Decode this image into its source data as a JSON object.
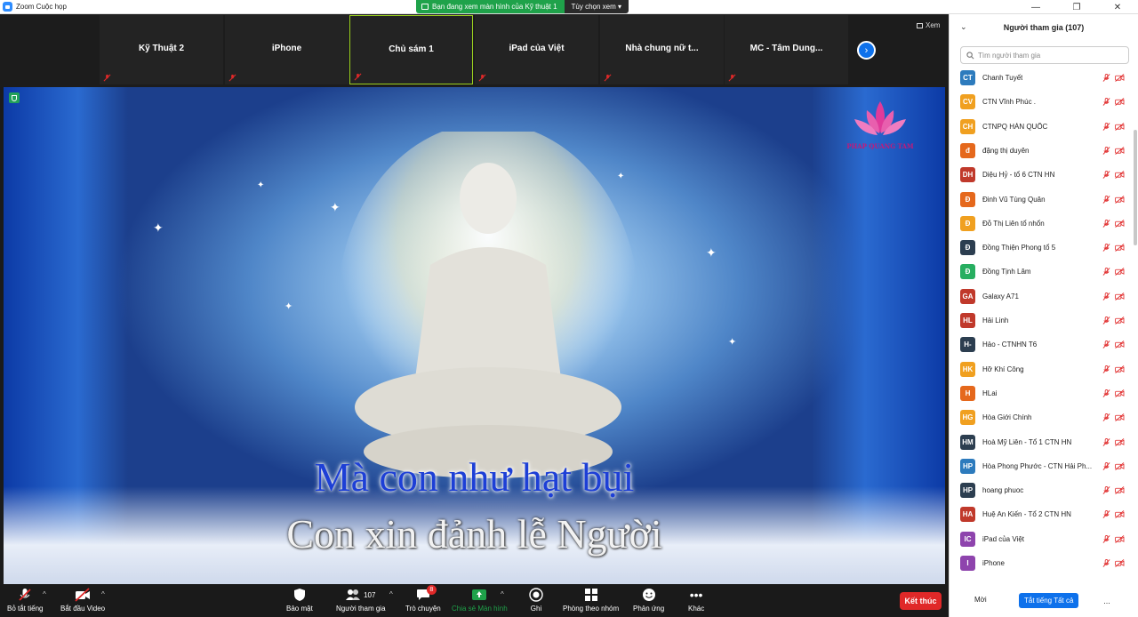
{
  "window": {
    "title": "Zoom Cuộc họp",
    "minimize": "—",
    "maximize": "❐",
    "close": "✕"
  },
  "share_banner": {
    "message": "Bạn đang xem màn hình của Kỹ thuật 1",
    "view_options": "Tùy chọn xem ▾"
  },
  "thumbnails": [
    {
      "name": "Kỹ Thuật 2"
    },
    {
      "name": "iPhone"
    },
    {
      "name": "Chủ sám 1"
    },
    {
      "name": "iPad của Việt"
    },
    {
      "name": "Nhà chung nữ t..."
    },
    {
      "name": "MC - Tâm Dung..."
    }
  ],
  "view_button": "Xem",
  "share_content": {
    "lyric_line_1": "Mà con như hạt bụi",
    "lyric_line_2": "Con xin đảnh lễ Người",
    "logo_text": "PHAP QUANG TAM"
  },
  "toolbar": {
    "mute_all": "Bỏ tắt tiếng",
    "start_video": "Bắt đầu Video",
    "security": "Bảo mật",
    "participants": "Người tham gia",
    "participants_count": "107",
    "chat": "Trò chuyện",
    "chat_badge": "8",
    "share_screen": "Chia sẻ Màn hình",
    "record": "Ghi",
    "breakout": "Phòng theo nhóm",
    "reactions": "Phản ứng",
    "more": "Khác",
    "end": "Kết thúc"
  },
  "panel": {
    "title": "Người tham gia (107)",
    "search_placeholder": "Tìm người tham gia",
    "participants": [
      {
        "initials": "CT",
        "name": "Chanh Tuyết",
        "color": "#2d7bbd"
      },
      {
        "initials": "CV",
        "name": "CTN Vĩnh Phúc .",
        "color": "#f0a020"
      },
      {
        "initials": "CH",
        "name": "CTNPQ HÀN QUỐC",
        "color": "#f0a020"
      },
      {
        "initials": "đ",
        "name": "đặng thị duyên",
        "color": "#e5681c"
      },
      {
        "initials": "DH",
        "name": "Diệu Hỷ - tổ 6 CTN HN",
        "color": "#c0392b"
      },
      {
        "initials": "Đ",
        "name": "Đinh Vũ Tùng Quân",
        "color": "#e5681c"
      },
      {
        "initials": "Đ",
        "name": "Đỗ Thị Liên tổ nhổn",
        "color": "#f0a020"
      },
      {
        "initials": "Đ",
        "name": "Đồng Thiện Phong tổ 5",
        "color": "#2c3e50"
      },
      {
        "initials": "Đ",
        "name": "Đồng Tịnh Lâm",
        "color": "#27ae60"
      },
      {
        "initials": "GA",
        "name": "Galaxy A71",
        "color": "#c0392b"
      },
      {
        "initials": "HL",
        "name": "Hải Linh",
        "color": "#c0392b"
      },
      {
        "initials": "H-",
        "name": "Hảo - CTNHN T6",
        "color": "#2c3e50"
      },
      {
        "initials": "HK",
        "name": "Hỡ Khí Công",
        "color": "#f0a020"
      },
      {
        "initials": "H",
        "name": "HLai",
        "color": "#e5681c"
      },
      {
        "initials": "HG",
        "name": "Hòa Giới Chính",
        "color": "#f0a020"
      },
      {
        "initials": "HM",
        "name": "Hoà Mỹ Liên - Tổ 1 CTN HN",
        "color": "#2c3e50"
      },
      {
        "initials": "HP",
        "name": "Hòa Phong Phước - CTN Hải Ph...",
        "color": "#2d7bbd"
      },
      {
        "initials": "HP",
        "name": "hoang phuoc",
        "color": "#2c3e50"
      },
      {
        "initials": "HA",
        "name": "Huệ An Kiến - Tổ 2 CTN HN",
        "color": "#c0392b"
      },
      {
        "initials": "IC",
        "name": "iPad của Việt",
        "color": "#8e44ad"
      },
      {
        "initials": "I",
        "name": "iPhone",
        "color": "#8e44ad"
      }
    ],
    "invite": "Mời",
    "mute_all": "Tắt tiếng Tất cả",
    "more": "..."
  }
}
